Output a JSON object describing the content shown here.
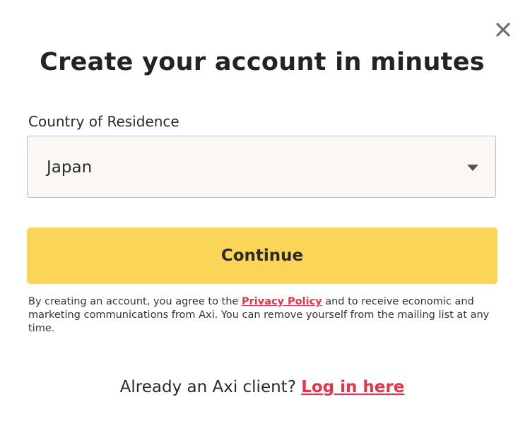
{
  "modal": {
    "title": "Create your account in minutes",
    "close_icon": "close-icon"
  },
  "form": {
    "country_label": "Country of Residence",
    "country_value": "Japan",
    "dropdown_icon": "caret-down-icon",
    "continue_label": "Continue"
  },
  "legal": {
    "text_before": "By creating an account, you agree to the ",
    "privacy_link": "Privacy Policy",
    "text_after": " and to receive economic and marketing communications from Axi. You can remove yourself from the mailing list at any time."
  },
  "login": {
    "prompt": "Already an Axi client? ",
    "link": "Log in here"
  },
  "colors": {
    "accent_button": "#fbd558",
    "link": "#e8334a",
    "select_bg": "#fbf8f3",
    "text": "#232323"
  }
}
